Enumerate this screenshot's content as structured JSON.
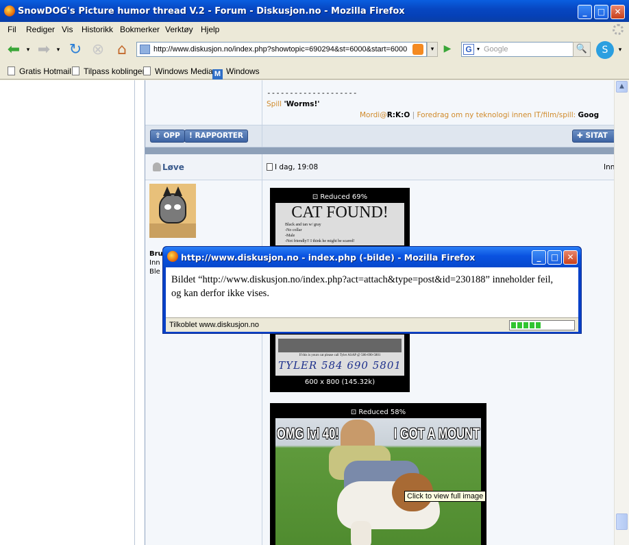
{
  "window": {
    "title": "SnowDOG's Picture humor thread V.2 - Forum - Diskusjon.no - Mozilla Firefox"
  },
  "menu": [
    "Fil",
    "Rediger",
    "Vis",
    "Historikk",
    "Bokmerker",
    "Verktøy",
    "Hjelp"
  ],
  "nav": {
    "url": "http://www.diskusjon.no/index.php?showtopic=690294&st=6000&start=6000",
    "search_placeholder": "Google"
  },
  "bookmarks": [
    "Gratis Hotmail",
    "Tilpass koblinger",
    "Windows Media",
    "Windows"
  ],
  "post_prev": {
    "divider": "--------------------",
    "game_label": "Spill",
    "game_value": "'Worms!'",
    "sig_user": "Mordi@",
    "sig_user_bold": "R:K:O",
    "sig_sep": "|",
    "sig_text": "Foredrag om ny teknologi innen IT/film/spill:",
    "sig_link": "Goog"
  },
  "buttons": {
    "opp": "OPP",
    "rapporter": "RAPPORTER",
    "sitat": "SITAT"
  },
  "post": {
    "author": "Løve",
    "date": "I dag, 19:08",
    "right_cut": "Inn",
    "side_lines": [
      "Bru",
      "Inn",
      "Ble"
    ],
    "images": [
      {
        "reduced": "Reduced 69%",
        "heading": "CAT FOUND!",
        "note_lines": [
          "Black and tan w/ gray",
          "-No collar",
          "-Male",
          "-Not friendly!! I think he might be scared!"
        ],
        "footer_note": "If this is yours cat please call Tyler ASAP @ 586-690-5801",
        "handwritten": "TYLER 584 690 5801",
        "size": "600 x 800 (145.32k)"
      },
      {
        "reduced": "Reduced 58%",
        "text_left": "OMG lvl 40!",
        "text_right": "I GOT A MOUNT"
      }
    ]
  },
  "dialog": {
    "title": "http://www.diskusjon.no - index.php (-bilde) - Mozilla Firefox",
    "line1": "Bildet “http://www.diskusjon.no/index.php?act=attach&type=post&id=230188” inneholder feil,",
    "line2": "og kan derfor ikke vises.",
    "status": "Tilkoblet www.diskusjon.no",
    "progress_fraction": 0.5
  },
  "tooltip": "Click to view full image"
}
